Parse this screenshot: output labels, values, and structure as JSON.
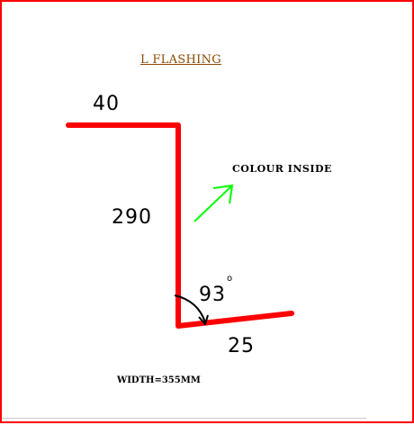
{
  "title": "L FLASHING",
  "dimensions": {
    "top": "40",
    "side": "290",
    "bottom": "25",
    "angle": "93",
    "angle_unit": "o"
  },
  "notes": {
    "colour_side": "COLOUR INSIDE",
    "width": "WIDTH=355MM"
  },
  "colors": {
    "flashing": "#ff0000",
    "arrow": "#00ff00",
    "border": "#ff0000",
    "title": "#8a4a00"
  }
}
